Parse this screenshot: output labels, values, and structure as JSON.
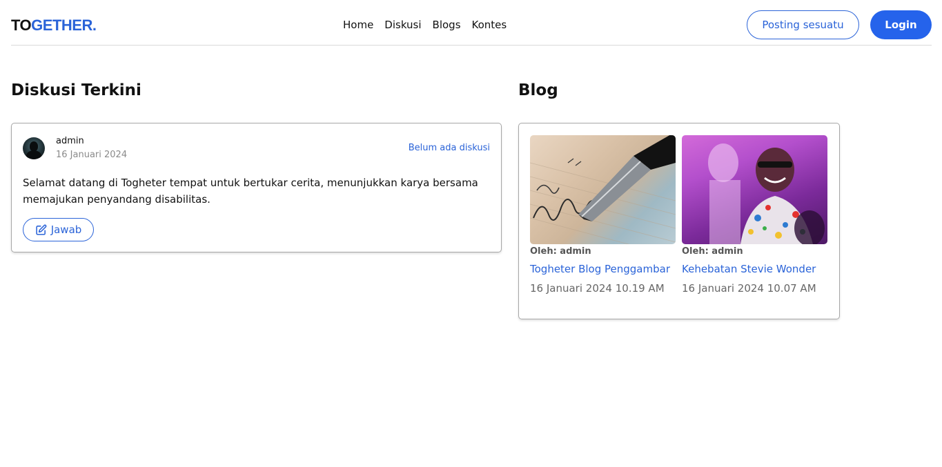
{
  "brand": {
    "logo_part1": "TO",
    "logo_part2": "GETHER."
  },
  "nav": {
    "items": [
      "Home",
      "Diskusi",
      "Blogs",
      "Kontes"
    ]
  },
  "header": {
    "post_label": "Posting sesuatu",
    "login_label": "Login"
  },
  "diskusi": {
    "section_title": "Diskusi Terkini",
    "post": {
      "user": "admin",
      "date": "16 Januari 2024",
      "status": "Belum ada diskusi",
      "text": "Selamat datang di Togheter tempat untuk bertukar cerita, menunjukkan karya bersama memajukan penyandang disabilitas.",
      "reply_label": "Jawab"
    }
  },
  "blog": {
    "section_title": "Blog",
    "items": [
      {
        "author": "Oleh: admin",
        "title": "Togheter Blog Penggambar",
        "date": "16 Januari 2024 10.19 AM"
      },
      {
        "author": "Oleh: admin",
        "title": "Kehebatan Stevie Wonder",
        "date": "16 Januari 2024 10.07 AM"
      }
    ]
  },
  "colors": {
    "accent": "#2563eb",
    "link": "#2a63d8",
    "border": "#a6a6a6"
  }
}
